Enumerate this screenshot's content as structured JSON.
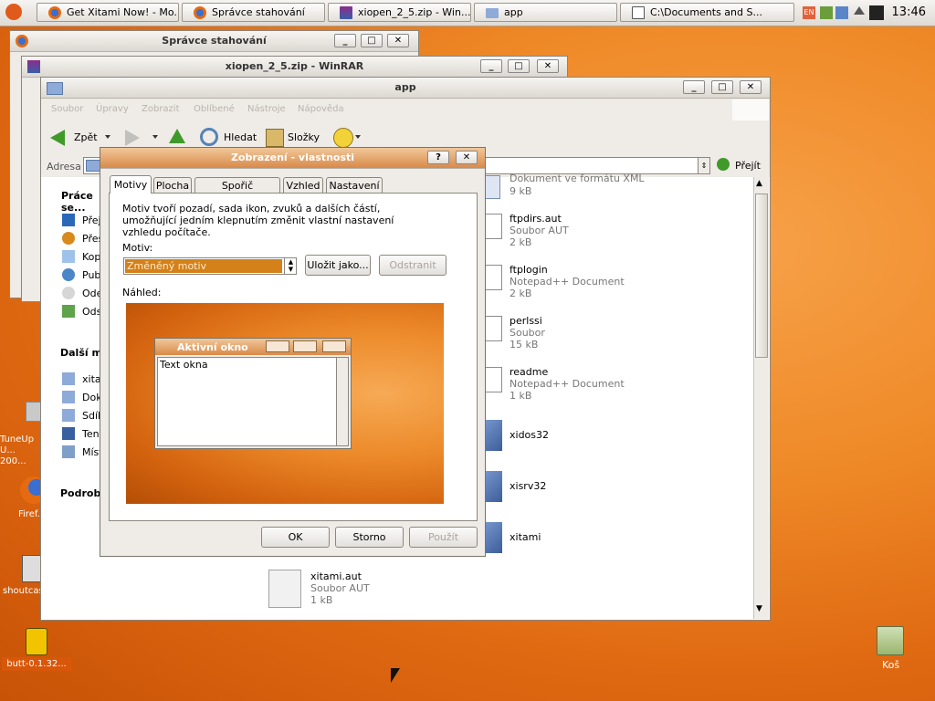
{
  "taskbar": {
    "tasks": [
      {
        "label": "Get Xitami Now! - Mo..."
      },
      {
        "label": "Správce stahování"
      },
      {
        "label": "xiopen_2_5.zip - Win..."
      },
      {
        "label": "app"
      },
      {
        "label": "C:\\Documents and S..."
      }
    ],
    "tray": {
      "lang": "EN"
    },
    "clock": "13:46"
  },
  "desktop": {
    "icons": [
      {
        "label": "TuneUp U... 200..."
      },
      {
        "label": "Firef..."
      },
      {
        "label": "shoutcas..."
      },
      {
        "label": "butt-0.1.32..."
      },
      {
        "label": "Koš"
      }
    ]
  },
  "download_window": {
    "title": "Správce stahování"
  },
  "winrar_window": {
    "title": "xiopen_2_5.zip - WinRAR"
  },
  "explorer": {
    "title": "app",
    "menu": [
      "Soubor",
      "Úpravy",
      "Zobrazit",
      "Oblíbené",
      "Nástroje",
      "Nápověda"
    ],
    "toolbar": {
      "back": "Zpět",
      "search": "Hledat",
      "folders": "Složky"
    },
    "address_label": "Adresa",
    "go_label": "Přejít",
    "sidebar": {
      "tasks_title": "Práce se...",
      "task_items": [
        "Přej...",
        "Přes...",
        "Kopí...",
        "Publ...",
        "Ode...",
        "Ods..."
      ],
      "other_title": "Další mí...",
      "other_items": [
        "xitam...",
        "Doku...",
        "Sdíle...",
        "Tento...",
        "Míst..."
      ],
      "details_title": "Podrobn..."
    },
    "files": [
      {
        "name": "Dokument ve formátu XML",
        "type": "",
        "size": "9 kB"
      },
      {
        "name": "ftpdirs.aut",
        "type": "Soubor AUT",
        "size": "2 kB"
      },
      {
        "name": "ftplogin",
        "type": "Notepad++ Document",
        "size": "2 kB"
      },
      {
        "name": "perlssi",
        "type": "Soubor",
        "size": "15 kB"
      },
      {
        "name": "readme",
        "type": "Notepad++ Document",
        "size": "1 kB"
      },
      {
        "name": "xidos32",
        "type": "",
        "size": ""
      },
      {
        "name": "xisrv32",
        "type": "",
        "size": ""
      },
      {
        "name": "xitami",
        "type": "",
        "size": ""
      },
      {
        "name": "xitami.aut",
        "type": "Soubor AUT",
        "size": "1 kB"
      }
    ]
  },
  "dialog": {
    "title": "Zobrazení - vlastnosti",
    "tabs": [
      "Motivy",
      "Plocha",
      "Spořič obrazovky",
      "Vzhled",
      "Nastavení"
    ],
    "description": "Motiv tvoří pozadí, sada ikon, zvuků a dalších částí, umožňující jedním klepnutím změnit vlastní nastavení vzhledu počítače.",
    "motiv_label": "Motiv:",
    "motiv_value": "Změněný motiv",
    "save_as": "Uložit jako...",
    "delete": "Odstranit",
    "preview_label": "Náhled:",
    "preview_window_title": "Aktivní okno",
    "preview_window_text": "Text okna",
    "ok": "OK",
    "cancel": "Storno",
    "apply": "Použít"
  }
}
